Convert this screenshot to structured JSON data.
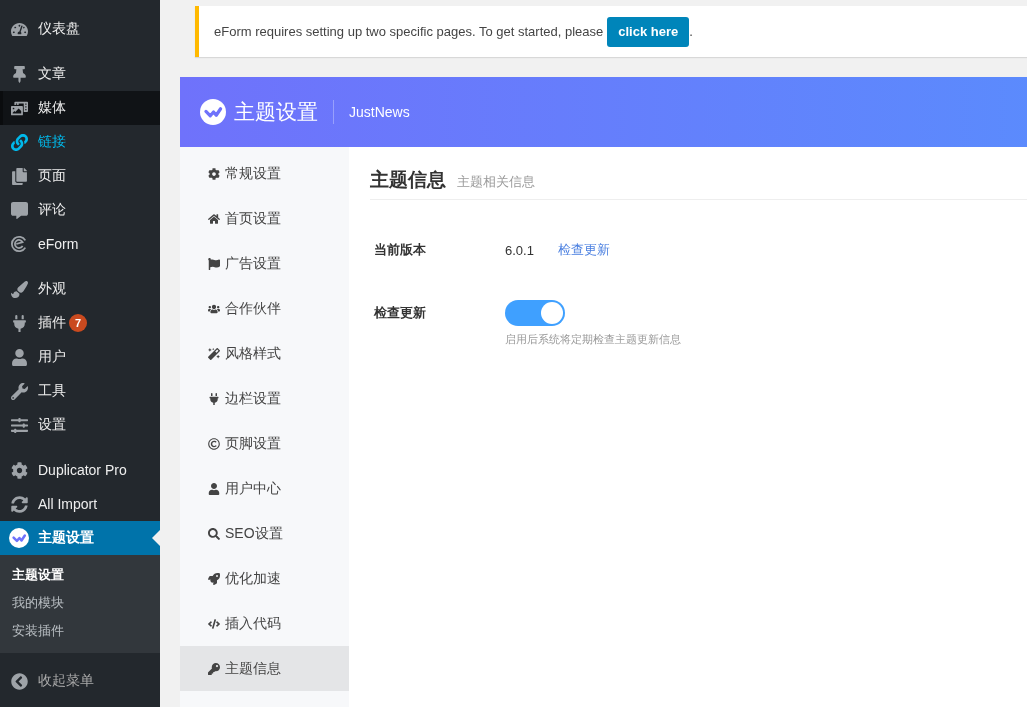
{
  "admin_menu": [
    {
      "items": [
        {
          "label": "仪表盘",
          "selected": false,
          "hovered": false,
          "highlighted": false
        }
      ]
    },
    {
      "items": [
        {
          "label": "文章",
          "selected": false,
          "hovered": false,
          "highlighted": false
        },
        {
          "label": "媒体",
          "selected": false,
          "hovered": true,
          "highlighted": false
        },
        {
          "label": "链接",
          "selected": false,
          "hovered": false,
          "highlighted": true
        },
        {
          "label": "页面",
          "selected": false,
          "hovered": false,
          "highlighted": false
        },
        {
          "label": "评论",
          "selected": false,
          "hovered": false,
          "highlighted": false
        },
        {
          "label": "eForm",
          "selected": false,
          "hovered": false,
          "highlighted": false
        }
      ]
    },
    {
      "items": [
        {
          "label": "外观",
          "selected": false,
          "hovered": false,
          "highlighted": false
        },
        {
          "label": "插件",
          "badge": "7",
          "selected": false,
          "hovered": false,
          "highlighted": false
        },
        {
          "label": "用户",
          "selected": false,
          "hovered": false,
          "highlighted": false
        },
        {
          "label": "工具",
          "selected": false,
          "hovered": false,
          "highlighted": false
        },
        {
          "label": "设置",
          "selected": false,
          "hovered": false,
          "highlighted": false
        }
      ]
    },
    {
      "items": [
        {
          "label": "Duplicator Pro",
          "selected": false,
          "hovered": false,
          "highlighted": false
        },
        {
          "label": "All Import",
          "selected": false,
          "hovered": false,
          "highlighted": false
        },
        {
          "label": "主题设置",
          "selected": true,
          "hovered": false,
          "highlighted": false,
          "children": [
            {
              "label": "主题设置",
              "selected": true
            },
            {
              "label": "我的模块",
              "selected": false
            },
            {
              "label": "安装插件",
              "selected": false
            }
          ]
        }
      ]
    }
  ],
  "collapse_menu": "收起菜单",
  "notice": {
    "text": "eForm requires setting up two specific pages. To get started, please",
    "button": "click here",
    "trailing": "."
  },
  "panel": {
    "title": "主题设置",
    "subtitle": "JustNews",
    "tabs": [
      {
        "label": "常规设置",
        "selected": false
      },
      {
        "label": "首页设置",
        "selected": false
      },
      {
        "label": "广告设置",
        "selected": false
      },
      {
        "label": "合作伙伴",
        "selected": false
      },
      {
        "label": "风格样式",
        "selected": false
      },
      {
        "label": "边栏设置",
        "selected": false
      },
      {
        "label": "页脚设置",
        "selected": false
      },
      {
        "label": "用户中心",
        "selected": false
      },
      {
        "label": "SEO设置",
        "selected": false
      },
      {
        "label": "优化加速",
        "selected": false
      },
      {
        "label": "插入代码",
        "selected": false
      },
      {
        "label": "主题信息",
        "selected": true
      }
    ],
    "section": {
      "title": "主题信息",
      "subtitle": "主题相关信息"
    },
    "fields": [
      {
        "kind": "text",
        "label": "当前版本",
        "value": "6.0.1",
        "link": "检查更新"
      },
      {
        "kind": "toggle",
        "label": "检查更新",
        "on": true,
        "hint": "启用后系统将定期检查主题更新信息"
      }
    ]
  }
}
